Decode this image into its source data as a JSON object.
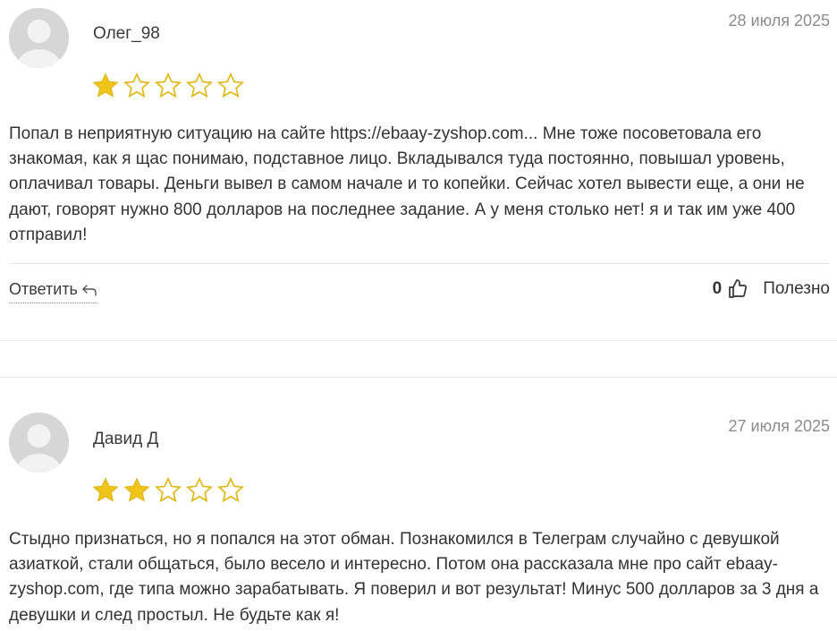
{
  "reviews": [
    {
      "author": "Олег_98",
      "date": "28 июля 2025",
      "rating": 1,
      "max_rating": 5,
      "text": "Попал в неприятную ситуацию на сайте https://ebaay-zyshop.com... Мне тоже посоветовала его знакомая, как я щас понимаю, подставное лицо. Вкладывался туда постоянно, повышал уровень, оплачивал товары. Деньги вывел в самом начале и то копейки. Сейчас хотел вывести еще, а они не дают, говорят нужно 800 долларов на последнее задание. А у меня столько нет! я и так им уже 400 отправил!",
      "reply_label": "Ответить",
      "votes": "0",
      "useful_label": "Полезно"
    },
    {
      "author": "Давид Д",
      "date": "27 июля 2025",
      "rating": 2,
      "max_rating": 5,
      "text": "Стыдно признаться, но я попался на этот обман. Познакомился в Телеграм случайно с девушкой азиаткой, стали общаться, было весело и интересно. Потом она рассказала мне про сайт ebaay-zyshop.com, где типа можно зарабатывать. Я поверил и вот результат! Минус 500 долларов за 3 дня а девушки и след простыл. Не будьте как я!"
    }
  ],
  "colors": {
    "star_filled": "#f0c419",
    "star_outline": "#e0b81a",
    "avatar_bg": "#d6d6d6",
    "date": "#8c8c8c"
  },
  "icons": {
    "avatar": "user-silhouette-icon",
    "star": "star-icon",
    "reply": "reply-arrow-icon",
    "thumb": "thumbs-up-icon"
  }
}
